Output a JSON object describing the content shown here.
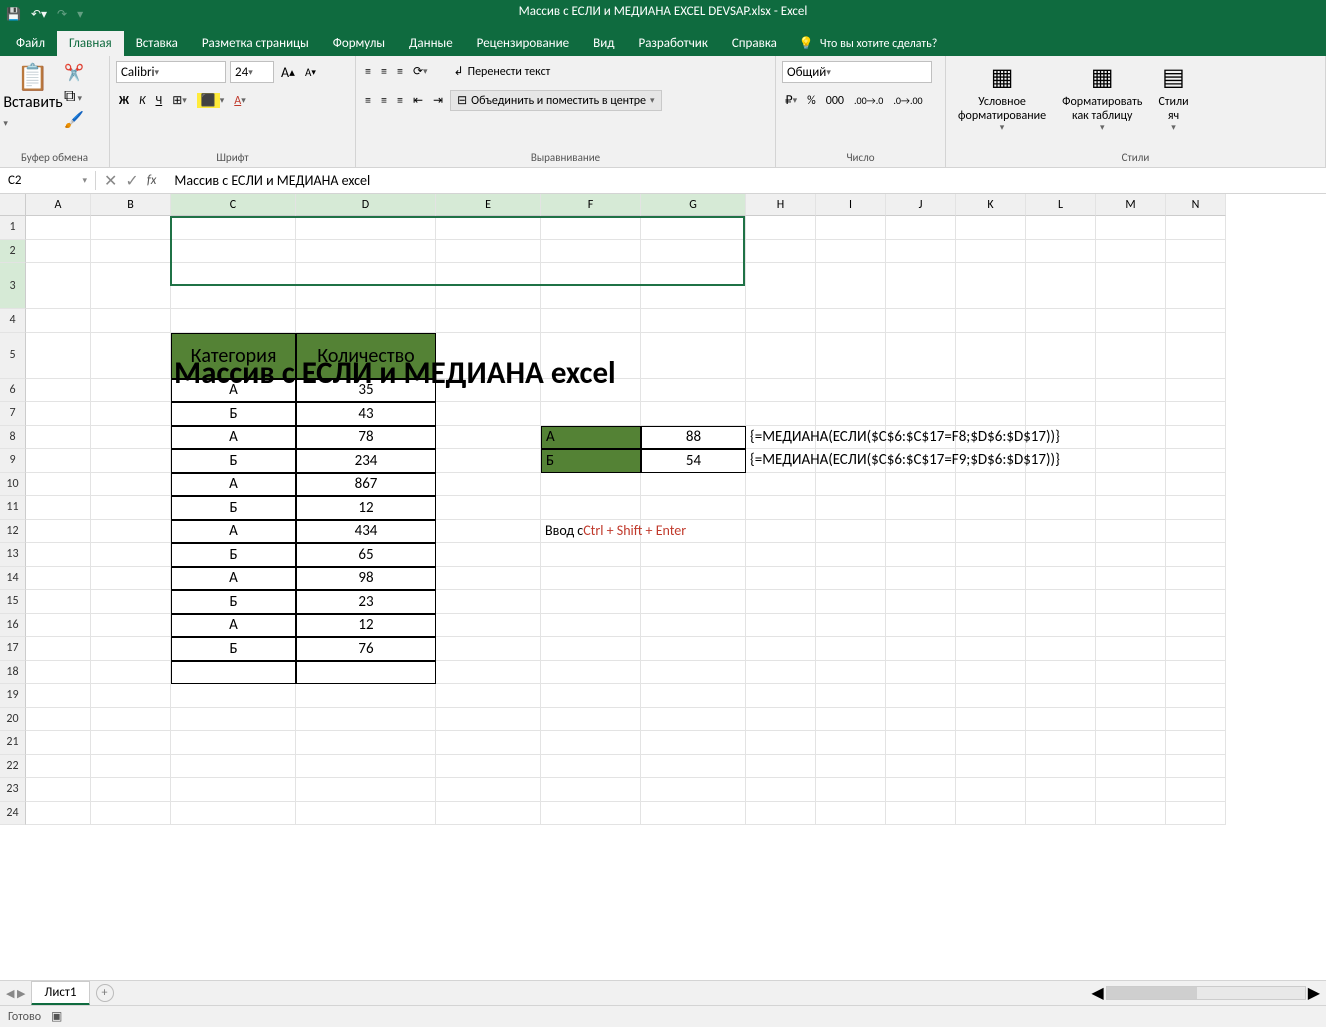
{
  "app": {
    "doc_title": "Массив с ЕСЛИ и МЕДИАНА EXCEL DEVSAP.xlsx  -  Excel"
  },
  "tabs": {
    "file": "Файл",
    "home": "Главная",
    "insert": "Вставка",
    "layout": "Разметка страницы",
    "formulas": "Формулы",
    "data": "Данные",
    "review": "Рецензирование",
    "view": "Вид",
    "dev": "Разработчик",
    "help": "Справка",
    "tell": "Что вы хотите сделать?"
  },
  "ribbon": {
    "paste": "Вставить",
    "clipboard": "Буфер обмена",
    "font_group": "Шрифт",
    "font": "Calibri",
    "size": "24",
    "align_group": "Выравнивание",
    "wrap": "Перенести текст",
    "merge": "Объединить и поместить в центре",
    "number_group": "Число",
    "format": "Общий",
    "styles_group": "Стили",
    "cond": "Условное",
    "cond2": "форматирование",
    "fmt_tbl": "Форматировать",
    "fmt_tbl2": "как таблицу",
    "cell_styles": "Стили",
    "cell_styles2": "яч"
  },
  "namebox": "C2",
  "formula_bar": "Массив с ЕСЛИ и МЕДИАНА excel",
  "columns": [
    "A",
    "B",
    "C",
    "D",
    "E",
    "F",
    "G",
    "H",
    "I",
    "J",
    "K",
    "L",
    "M",
    "N"
  ],
  "rows_count": 24,
  "title_cell": "Массив с ЕСЛИ и МЕДИАНА excel",
  "table": {
    "header": [
      "Категория",
      "Количество"
    ],
    "rows": [
      [
        "А",
        "35"
      ],
      [
        "Б",
        "43"
      ],
      [
        "А",
        "78"
      ],
      [
        "Б",
        "234"
      ],
      [
        "А",
        "867"
      ],
      [
        "Б",
        "12"
      ],
      [
        "А",
        "434"
      ],
      [
        "Б",
        "65"
      ],
      [
        "А",
        "98"
      ],
      [
        "Б",
        "23"
      ],
      [
        "А",
        "12"
      ],
      [
        "Б",
        "76"
      ]
    ]
  },
  "results": [
    {
      "label": "А",
      "value": "88",
      "formula": "{=МЕДИАНА(ЕСЛИ($C$6:$C$17=F8;$D$6:$D$17))}"
    },
    {
      "label": "Б",
      "value": "54",
      "formula": "{=МЕДИАНА(ЕСЛИ($C$6:$C$17=F9;$D$6:$D$17))}"
    }
  ],
  "hint": {
    "pre": "Ввод с ",
    "key": "Ctrl + Shift + Enter"
  },
  "sheet": "Лист1",
  "status": "Готово"
}
